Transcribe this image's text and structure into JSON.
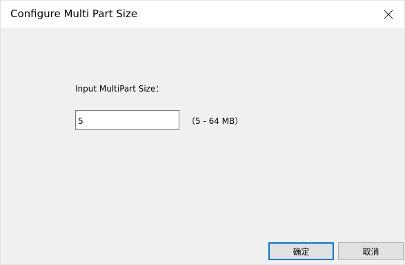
{
  "window": {
    "title": "Configure Multi Part Size",
    "close_icon": "close-icon"
  },
  "form": {
    "label": "Input MultiPart Size：",
    "value": "5",
    "range_hint": "（5 - 64 MB）"
  },
  "buttons": {
    "ok_label": "确定",
    "cancel_label": "取消"
  },
  "colors": {
    "dialog_background": "#f0f0f0",
    "title_bar_background": "#ffffff",
    "default_button_border": "#0078d7",
    "button_background": "#e1e1e1"
  }
}
